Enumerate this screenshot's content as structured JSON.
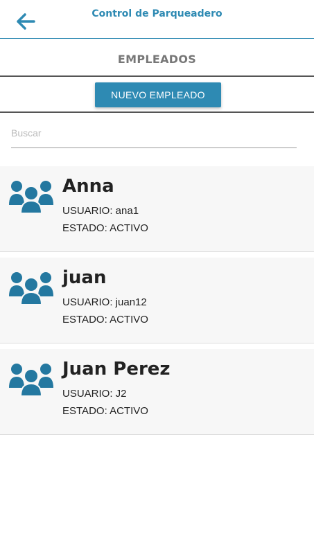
{
  "header": {
    "title": "Control de Parqueadero",
    "back_icon": "arrow-left-icon",
    "accent": "#2e8ab3"
  },
  "section": {
    "title": "EMPLEADOS",
    "new_button": "NUEVO EMPLEADO"
  },
  "search": {
    "placeholder": "Buscar",
    "value": ""
  },
  "employee_icon": "people-group-icon",
  "employees": [
    {
      "name": "Anna",
      "user_label": "USUARIO: ana1",
      "state_label": "ESTADO: ACTIVO"
    },
    {
      "name": "juan",
      "user_label": "USUARIO: juan12",
      "state_label": "ESTADO: ACTIVO"
    },
    {
      "name": "Juan Perez",
      "user_label": "USUARIO: J2",
      "state_label": "ESTADO: ACTIVO"
    }
  ]
}
